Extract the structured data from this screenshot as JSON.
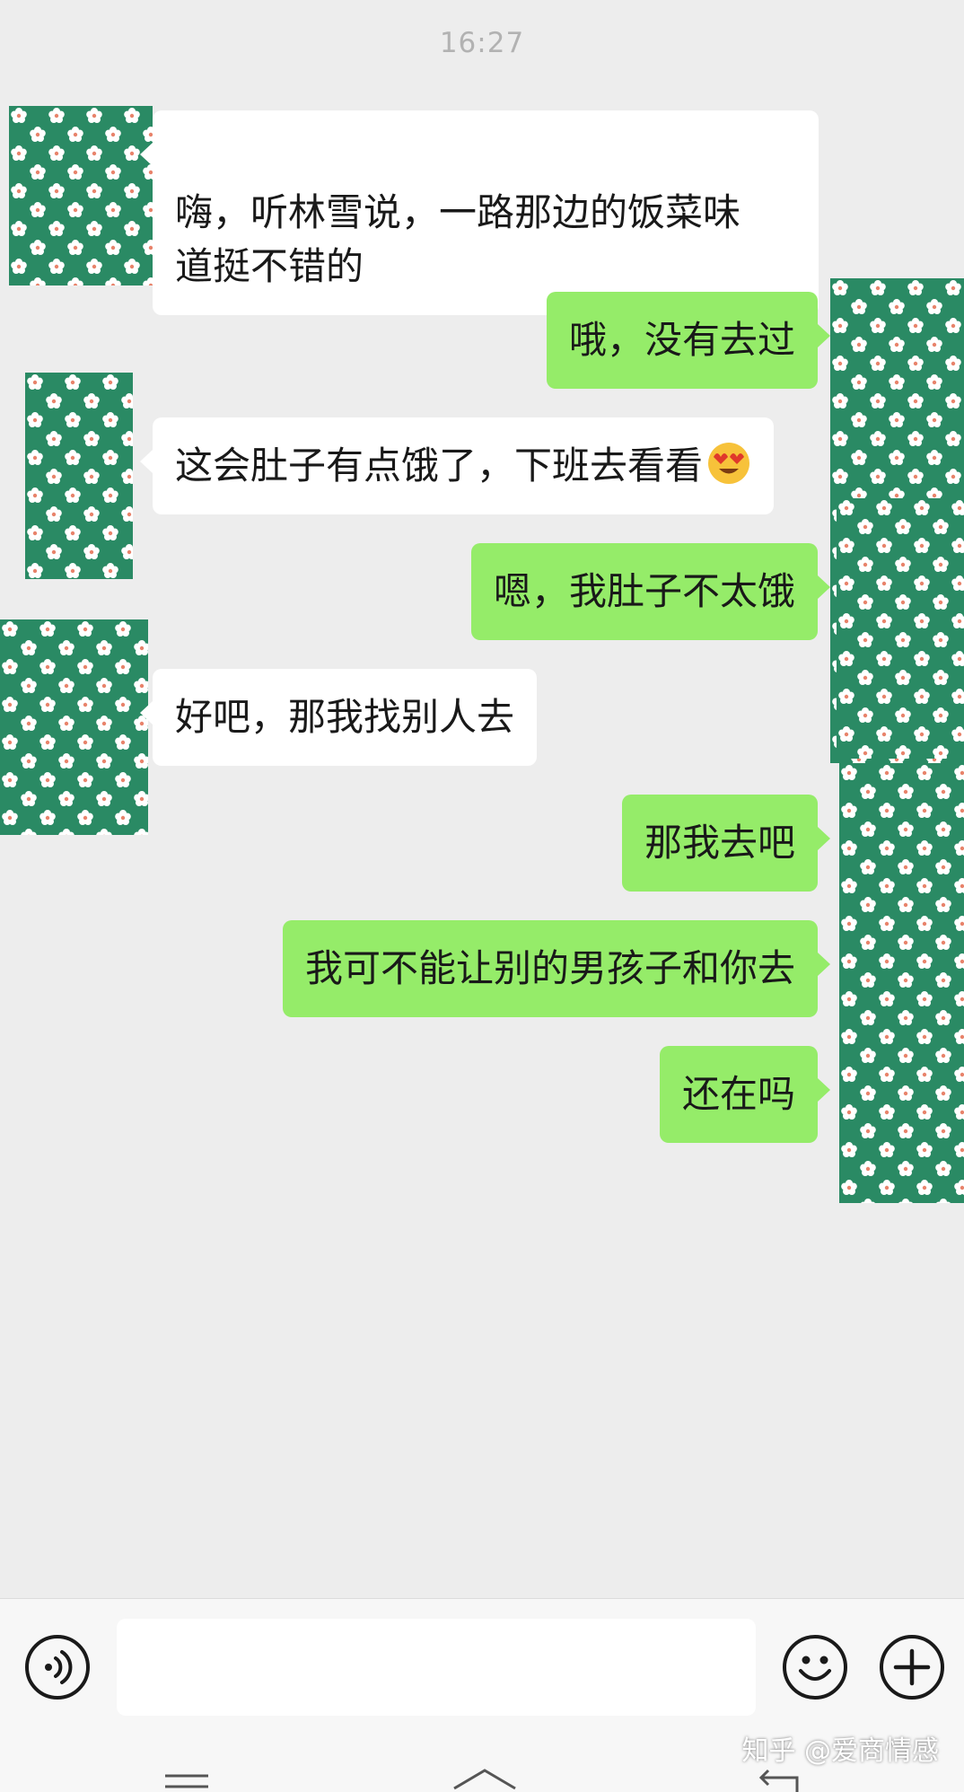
{
  "header": {
    "time": "16:27"
  },
  "messages": [
    {
      "from": "them",
      "text": "嗨，听林雪说，一路那边的饭菜味\n道挺不错的"
    },
    {
      "from": "me",
      "text": "哦，没有去过"
    },
    {
      "from": "them",
      "text": "这会肚子有点饿了，下班去看看",
      "emoji": "heart-eyes-emoji"
    },
    {
      "from": "me",
      "text": "嗯，我肚子不太饿"
    },
    {
      "from": "them",
      "text": "好吧，那我找别人去"
    },
    {
      "from": "me",
      "text": "那我去吧"
    },
    {
      "from": "me",
      "text": "我可不能让别的男孩子和你去"
    },
    {
      "from": "me",
      "text": "还在吗"
    }
  ],
  "input_bar": {
    "voice_icon": "voice-icon",
    "text_value": "",
    "emoji_icon": "smiley-icon",
    "more_icon": "plus-icon"
  },
  "watermark": "知乎 @爱商情感",
  "colors": {
    "background": "#ededed",
    "incoming_bubble": "#ffffff",
    "outgoing_bubble": "#95ec69",
    "avatar_green": "#2a8a64"
  }
}
